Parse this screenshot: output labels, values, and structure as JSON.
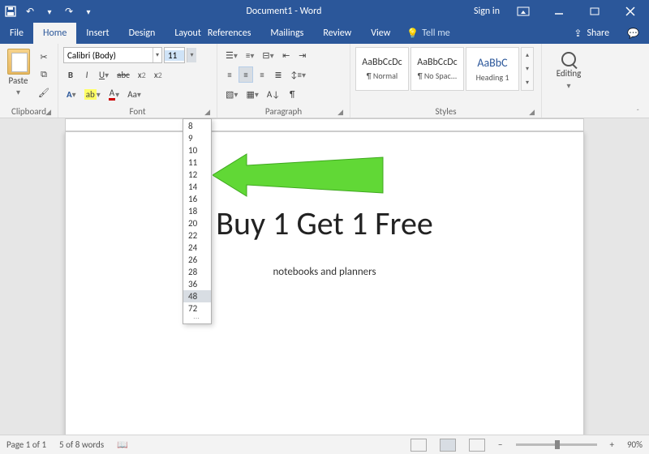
{
  "titlebar": {
    "doc_name": "Document1",
    "app_name": "Word",
    "sep": " - ",
    "sign_in": "Sign in"
  },
  "tabs": {
    "file": "File",
    "home": "Home",
    "insert": "Insert",
    "design": "Design",
    "layout": "Layout",
    "references": "References",
    "mailings": "Mailings",
    "review": "Review",
    "view": "View",
    "tell_me": "Tell me",
    "share": "Share"
  },
  "ribbon": {
    "clipboard": {
      "label": "Clipboard",
      "paste": "Paste"
    },
    "font": {
      "label": "Font",
      "name": "Calibri (Body)",
      "size": "11",
      "sizes": [
        "8",
        "9",
        "10",
        "11",
        "12",
        "14",
        "16",
        "18",
        "20",
        "22",
        "24",
        "26",
        "28",
        "36",
        "48",
        "72"
      ],
      "hover_size": "48"
    },
    "paragraph": {
      "label": "Paragraph"
    },
    "styles": {
      "label": "Styles",
      "preview": "AaBbCcDc",
      "items": [
        {
          "name": "¶ Normal"
        },
        {
          "name": "¶ No Spac..."
        },
        {
          "name": "Heading 1",
          "class": "h1",
          "preview": "AaBbC"
        }
      ]
    },
    "editing": {
      "label": "Editing"
    }
  },
  "document": {
    "heading": "Buy 1 Get 1 Free",
    "subtext": "notebooks and planners"
  },
  "statusbar": {
    "page": "Page 1 of 1",
    "words": "5 of 8 words",
    "zoom": "90%"
  }
}
